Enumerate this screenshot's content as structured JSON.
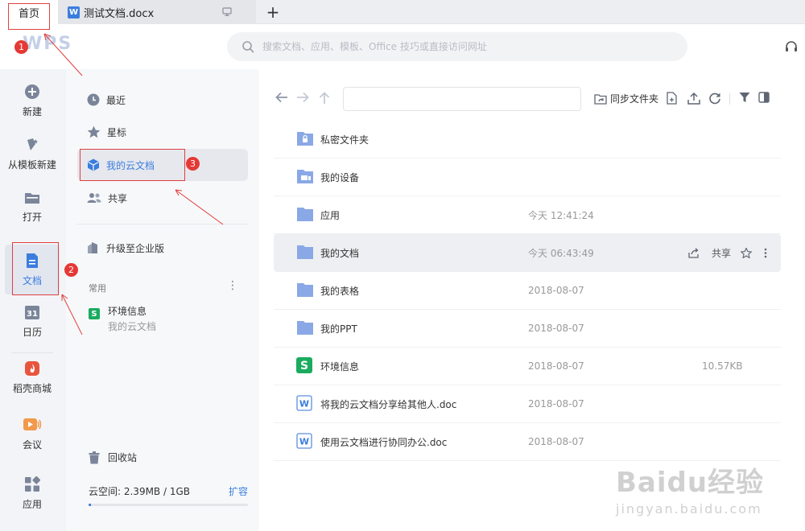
{
  "tabs": {
    "home": "首页",
    "doc": "测试文档.docx",
    "doc_icon_letter": "W",
    "add": "+"
  },
  "header": {
    "logo": "WPS",
    "search_placeholder": "搜索文档、应用、模板、Office 技巧或直接访问网址"
  },
  "leftnav": {
    "items": [
      {
        "label": "新建",
        "icon": "plus-circle-icon"
      },
      {
        "label": "从模板新建",
        "icon": "template-icon"
      },
      {
        "label": "打开",
        "icon": "folder-open-icon"
      },
      {
        "label": "文档",
        "icon": "document-icon"
      },
      {
        "label": "日历",
        "icon": "calendar-icon",
        "glyph": "31"
      },
      {
        "label": "稻壳商城",
        "icon": "docer-icon"
      },
      {
        "label": "会议",
        "icon": "meeting-icon"
      },
      {
        "label": "应用",
        "icon": "apps-icon"
      }
    ],
    "active": "文档"
  },
  "sidepanel": {
    "items": [
      {
        "label": "最近",
        "icon": "clock-icon"
      },
      {
        "label": "星标",
        "icon": "star-icon"
      },
      {
        "label": "我的云文档",
        "icon": "cloud-cube-icon"
      },
      {
        "label": "共享",
        "icon": "share-people-icon"
      }
    ],
    "upgrade": "升级至企业版",
    "section_title": "常用",
    "section_more": "⋮",
    "recent": {
      "name": "环境信息",
      "location": "我的云文档",
      "icon_letter": "S"
    },
    "recycle": "回收站",
    "storage": {
      "text": "云空间: 2.39MB / 1GB",
      "expand": "扩容",
      "used_fraction": 0.0023
    }
  },
  "toolbar": {
    "sync_label": "同步文件夹",
    "path_value": ""
  },
  "files": [
    {
      "name": "私密文件夹",
      "date": "",
      "size": "",
      "type": "folder-lock"
    },
    {
      "name": "我的设备",
      "date": "",
      "size": "",
      "type": "folder-device"
    },
    {
      "name": "应用",
      "date": "今天 12:41:24",
      "size": "",
      "type": "folder"
    },
    {
      "name": "我的文档",
      "date": "今天 06:43:49",
      "size": "",
      "type": "folder",
      "share": "共享"
    },
    {
      "name": "我的表格",
      "date": "2018-08-07",
      "size": "",
      "type": "folder"
    },
    {
      "name": "我的PPT",
      "date": "2018-08-07",
      "size": "",
      "type": "folder"
    },
    {
      "name": "环境信息",
      "date": "2018-08-07",
      "size": "10.57KB",
      "type": "sheet",
      "icon_letter": "S"
    },
    {
      "name": "将我的云文档分享给其他人.doc",
      "date": "2018-08-07",
      "size": "",
      "type": "doc",
      "icon_letter": "W"
    },
    {
      "name": "使用云文档进行协同办公.doc",
      "date": "2018-08-07",
      "size": "",
      "type": "doc",
      "icon_letter": "W"
    }
  ],
  "annotations": {
    "n1": "1",
    "n2": "2",
    "n3": "3"
  },
  "watermark": {
    "main": "Baidu经验",
    "sub": "jingyan.baidu.com"
  },
  "colors": {
    "accent": "#3b7ddd",
    "annotation": "#e53935",
    "sheet": "#1aab5f",
    "folder": "#8aa8e6"
  }
}
